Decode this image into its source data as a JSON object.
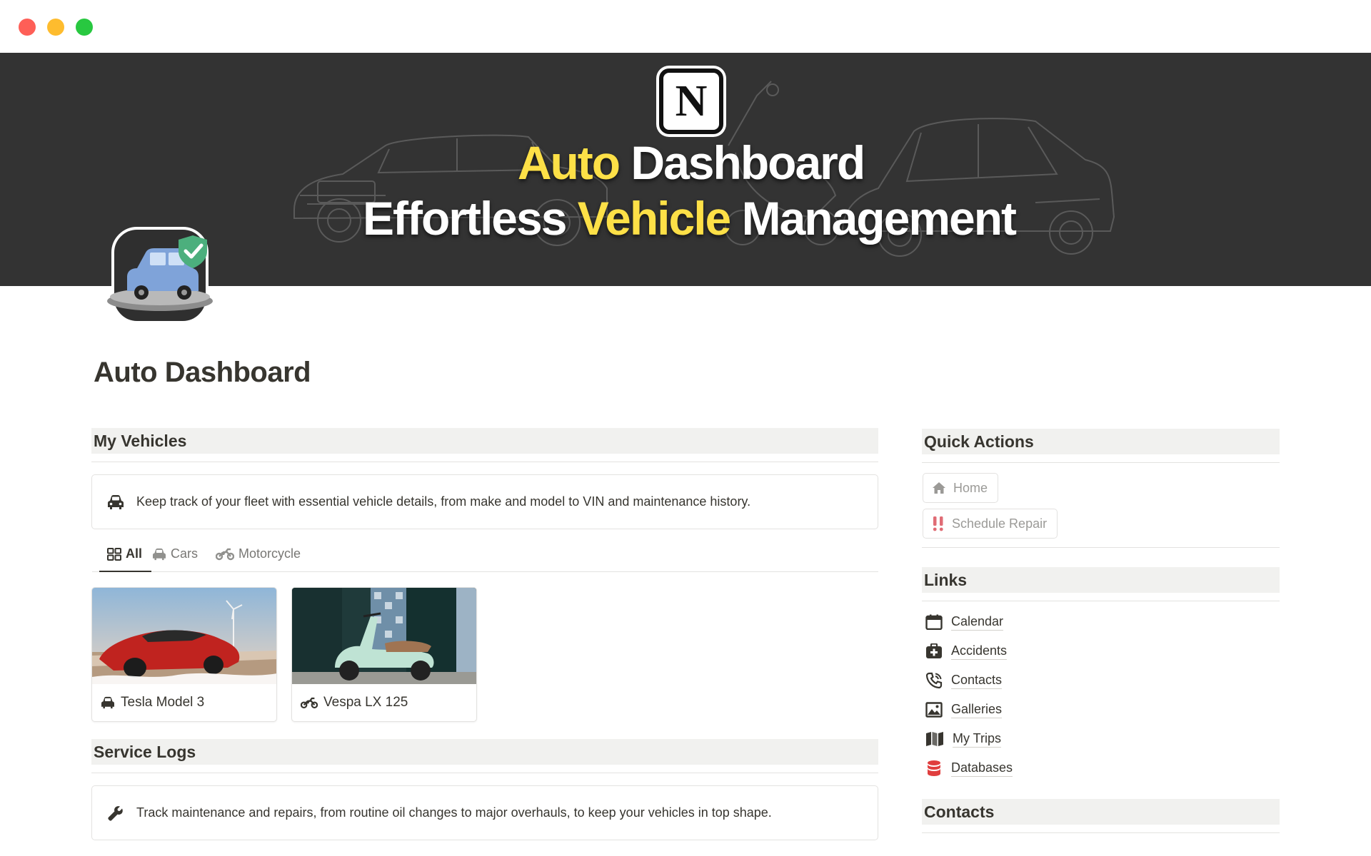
{
  "window": {
    "controls": [
      "close",
      "minimize",
      "maximize"
    ]
  },
  "cover": {
    "logo_letter": "N",
    "line1": [
      {
        "text": "Auto",
        "highlight": true
      },
      {
        "text": " Dashboard",
        "highlight": false
      }
    ],
    "line2": [
      {
        "text": "Effortless ",
        "highlight": false
      },
      {
        "text": "Vehicle",
        "highlight": true
      },
      {
        "text": " Management",
        "highlight": false
      }
    ],
    "highlight_color": "#fde047",
    "background_color": "#333333"
  },
  "page": {
    "icon": "car-shield-icon",
    "title": "Auto Dashboard"
  },
  "vehicles": {
    "heading": "My Vehicles",
    "callout_icon": "car-icon",
    "callout_text": "Keep track of your fleet with essential vehicle details, from make and model to VIN and maintenance history.",
    "tabs": [
      {
        "label": "All",
        "icon": "gallery-icon",
        "active": true
      },
      {
        "label": "Cars",
        "icon": "car-icon",
        "active": false
      },
      {
        "label": "Motorcycle",
        "icon": "motorcycle-icon",
        "active": false
      }
    ],
    "cards": [
      {
        "name": "Tesla Model 3",
        "icon": "car-icon"
      },
      {
        "name": "Vespa LX 125",
        "icon": "motorcycle-icon"
      }
    ]
  },
  "service_logs": {
    "heading": "Service Logs",
    "callout_icon": "wrench-icon",
    "callout_text": "Track maintenance and repairs, from routine oil changes to major overhauls, to keep your vehicles in top shape."
  },
  "quick_actions": {
    "heading": "Quick Actions",
    "buttons": [
      {
        "label": "Home",
        "icon": "home-icon"
      },
      {
        "label": "Schedule Repair",
        "icon": "double-exclamation-icon"
      }
    ]
  },
  "links": {
    "heading": "Links",
    "items": [
      {
        "label": "Calendar",
        "icon": "calendar-icon"
      },
      {
        "label": "Accidents",
        "icon": "first-aid-icon"
      },
      {
        "label": "Contacts",
        "icon": "phone-icon"
      },
      {
        "label": "Galleries",
        "icon": "image-icon"
      },
      {
        "label": "My Trips",
        "icon": "map-icon"
      },
      {
        "label": "Databases",
        "icon": "database-icon"
      }
    ]
  },
  "contacts": {
    "heading": "Contacts"
  },
  "colors": {
    "text": "#37352f",
    "muted": "#9b9a97",
    "section_bg": "#f1f1ef",
    "border": "#e3e2e0",
    "database_red": "#e03e3e",
    "alert_red": "#e06c75"
  }
}
